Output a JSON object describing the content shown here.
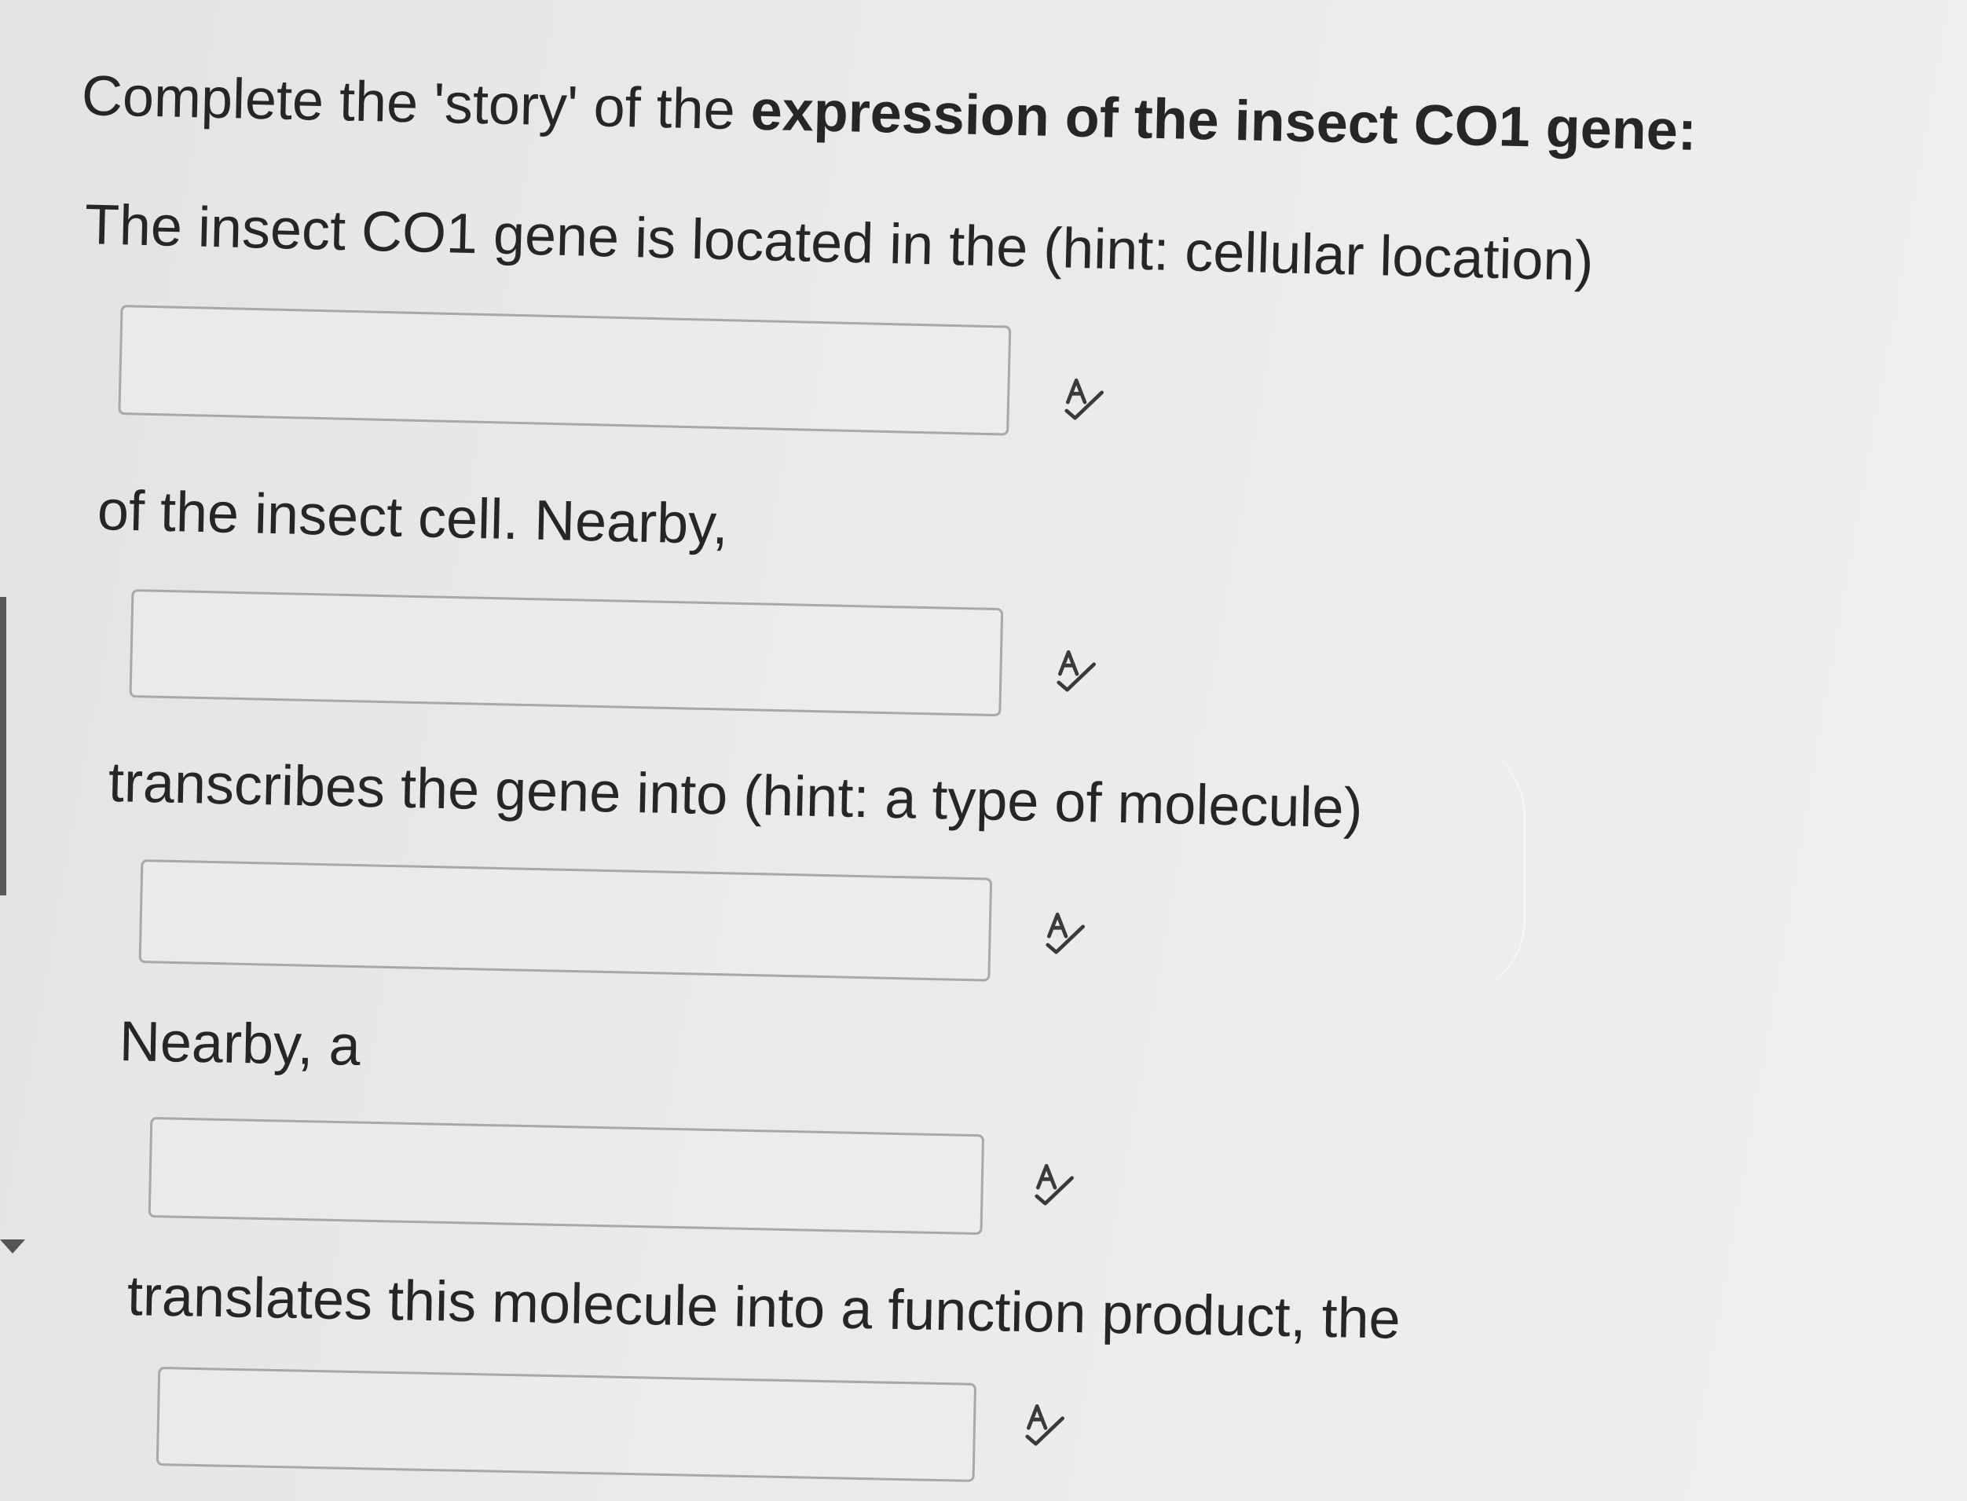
{
  "question": {
    "title_plain": "Complete the 'story' of the",
    "title_bold": "expression of the insect CO1 gene:",
    "prompts": [
      "The insect CO1 gene is located in the (hint: cellular location)",
      "of the insect cell. Nearby,",
      "transcribes the gene into (hint: a type of molecule)",
      "Nearby, a",
      "translates this molecule into a function product, the"
    ]
  },
  "blanks": [
    {
      "value": "",
      "placeholder": ""
    },
    {
      "value": "",
      "placeholder": ""
    },
    {
      "value": "",
      "placeholder": ""
    },
    {
      "value": "",
      "placeholder": ""
    },
    {
      "value": "",
      "placeholder": ""
    }
  ],
  "icons": {
    "spellcheck": "spellcheck-icon"
  },
  "colors": {
    "text": "#262626",
    "border": "#a8a8a8",
    "icon": "#3a3a3a"
  }
}
